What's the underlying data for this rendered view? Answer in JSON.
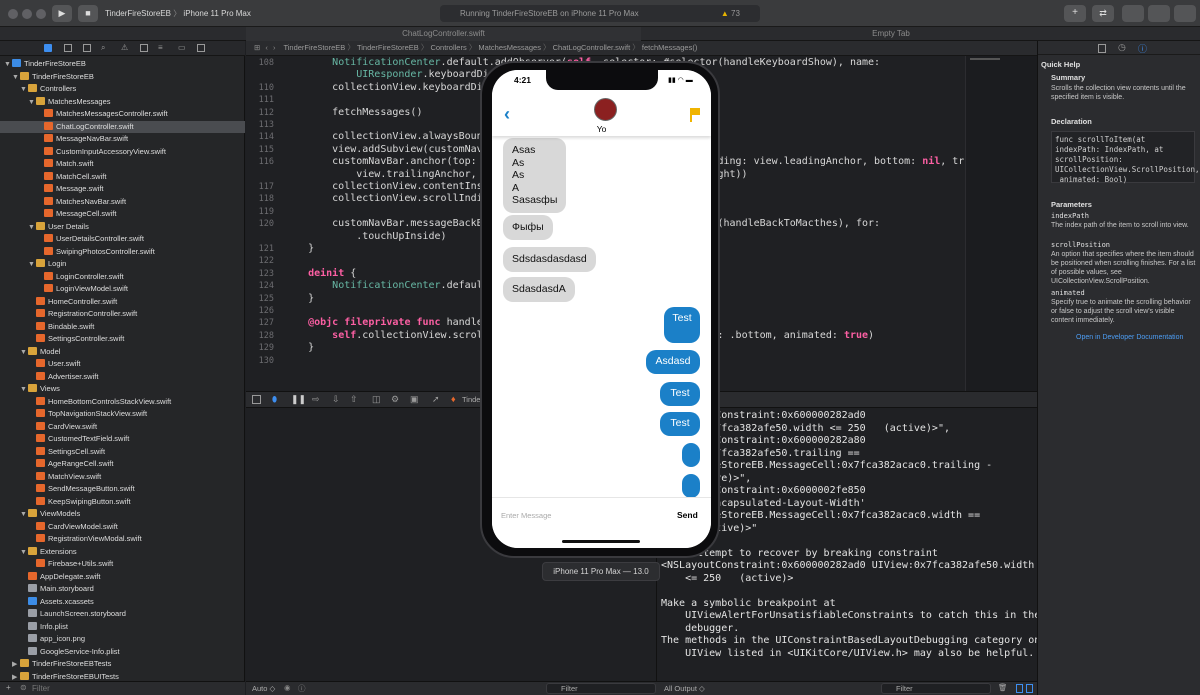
{
  "toolbar": {
    "scheme": "TinderFireStoreEB",
    "device": "iPhone 11 Pro Max",
    "status": "Running TinderFireStoreEB on iPhone 11 Pro Max",
    "warning_count": "73"
  },
  "tabs": [
    "ChatLogController.swift",
    "Empty Tab"
  ],
  "jumpbar": [
    "TinderFireStoreEB",
    "TinderFireStoreEB",
    "Controllers",
    "MatchesMessages",
    "ChatLogController.swift",
    "fetchMessages()"
  ],
  "tree": [
    {
      "label": "TinderFireStoreEB",
      "depth": 0,
      "type": "blu",
      "arrow": "▼"
    },
    {
      "label": "TinderFireStoreEB",
      "depth": 1,
      "type": "fold",
      "arrow": "▼"
    },
    {
      "label": "Controllers",
      "depth": 2,
      "type": "fold",
      "arrow": "▼"
    },
    {
      "label": "MatchesMessages",
      "depth": 3,
      "type": "fold",
      "arrow": "▼"
    },
    {
      "label": "MatchesMessagesController.swift",
      "depth": 4,
      "type": "sw",
      "arrow": ""
    },
    {
      "label": "ChatLogController.swift",
      "depth": 4,
      "type": "sw",
      "arrow": "",
      "selected": true
    },
    {
      "label": "MessageNavBar.swift",
      "depth": 4,
      "type": "sw",
      "arrow": ""
    },
    {
      "label": "CustomInputAccessoryView.swift",
      "depth": 4,
      "type": "sw",
      "arrow": ""
    },
    {
      "label": "Match.swift",
      "depth": 4,
      "type": "sw",
      "arrow": ""
    },
    {
      "label": "MatchCell.swift",
      "depth": 4,
      "type": "sw",
      "arrow": ""
    },
    {
      "label": "Message.swift",
      "depth": 4,
      "type": "sw",
      "arrow": ""
    },
    {
      "label": "MatchesNavBar.swift",
      "depth": 4,
      "type": "sw",
      "arrow": ""
    },
    {
      "label": "MessageCell.swift",
      "depth": 4,
      "type": "sw",
      "arrow": ""
    },
    {
      "label": "User Details",
      "depth": 3,
      "type": "fold",
      "arrow": "▼"
    },
    {
      "label": "UserDetailsController.swift",
      "depth": 4,
      "type": "sw",
      "arrow": ""
    },
    {
      "label": "SwipingPhotosController.swift",
      "depth": 4,
      "type": "sw",
      "arrow": ""
    },
    {
      "label": "Login",
      "depth": 3,
      "type": "fold",
      "arrow": "▼"
    },
    {
      "label": "LoginController.swift",
      "depth": 4,
      "type": "sw",
      "arrow": ""
    },
    {
      "label": "LoginViewModel.swift",
      "depth": 4,
      "type": "sw",
      "arrow": ""
    },
    {
      "label": "HomeController.swift",
      "depth": 3,
      "type": "sw",
      "arrow": ""
    },
    {
      "label": "RegistrationController.swift",
      "depth": 3,
      "type": "sw",
      "arrow": ""
    },
    {
      "label": "Bindable.swift",
      "depth": 3,
      "type": "sw",
      "arrow": ""
    },
    {
      "label": "SettingsController.swift",
      "depth": 3,
      "type": "sw",
      "arrow": ""
    },
    {
      "label": "Model",
      "depth": 2,
      "type": "fold",
      "arrow": "▼"
    },
    {
      "label": "User.swift",
      "depth": 3,
      "type": "sw",
      "arrow": ""
    },
    {
      "label": "Advertiser.swift",
      "depth": 3,
      "type": "sw",
      "arrow": ""
    },
    {
      "label": "Views",
      "depth": 2,
      "type": "fold",
      "arrow": "▼"
    },
    {
      "label": "HomeBottomControlsStackView.swift",
      "depth": 3,
      "type": "sw",
      "arrow": ""
    },
    {
      "label": "TopNavigationStackView.swift",
      "depth": 3,
      "type": "sw",
      "arrow": ""
    },
    {
      "label": "CardView.swift",
      "depth": 3,
      "type": "sw",
      "arrow": ""
    },
    {
      "label": "CustomedTextField.swift",
      "depth": 3,
      "type": "sw",
      "arrow": ""
    },
    {
      "label": "SettingsCell.swift",
      "depth": 3,
      "type": "sw",
      "arrow": ""
    },
    {
      "label": "AgeRangeCell.swift",
      "depth": 3,
      "type": "sw",
      "arrow": ""
    },
    {
      "label": "MatchView.swift",
      "depth": 3,
      "type": "sw",
      "arrow": ""
    },
    {
      "label": "SendMessageButton.swift",
      "depth": 3,
      "type": "sw",
      "arrow": ""
    },
    {
      "label": "KeepSwipingButton.swift",
      "depth": 3,
      "type": "sw",
      "arrow": ""
    },
    {
      "label": "ViewModels",
      "depth": 2,
      "type": "fold",
      "arrow": "▼"
    },
    {
      "label": "CardViewModel.swift",
      "depth": 3,
      "type": "sw",
      "arrow": ""
    },
    {
      "label": "RegistrationViewModal.swift",
      "depth": 3,
      "type": "sw",
      "arrow": ""
    },
    {
      "label": "Extensions",
      "depth": 2,
      "type": "fold",
      "arrow": "▼"
    },
    {
      "label": "Firebase+Utils.swift",
      "depth": 3,
      "type": "sw",
      "arrow": ""
    },
    {
      "label": "AppDelegate.swift",
      "depth": 2,
      "type": "sw",
      "arrow": ""
    },
    {
      "label": "Main.storyboard",
      "depth": 2,
      "type": "oth",
      "arrow": ""
    },
    {
      "label": "Assets.xcassets",
      "depth": 2,
      "type": "blu",
      "arrow": ""
    },
    {
      "label": "LaunchScreen.storyboard",
      "depth": 2,
      "type": "oth",
      "arrow": ""
    },
    {
      "label": "Info.plist",
      "depth": 2,
      "type": "oth",
      "arrow": ""
    },
    {
      "label": "app_icon.png",
      "depth": 2,
      "type": "oth",
      "arrow": ""
    },
    {
      "label": "GoogleService-Info.plist",
      "depth": 2,
      "type": "oth",
      "arrow": ""
    },
    {
      "label": "TinderFireStoreEBTests",
      "depth": 1,
      "type": "fold",
      "arrow": "▶"
    },
    {
      "label": "TinderFireStoreEBUITests",
      "depth": 1,
      "type": "fold",
      "arrow": "▶"
    }
  ],
  "code": [
    {
      "n": "108",
      "html": "    NotificationCenter.default.addObserver(self, selector: #selector(handleKeyboardShow), name:"
    },
    {
      "n": "",
      "html": "        UIResponder.keyboardDidShowNotification, object: nil)"
    },
    {
      "n": "110",
      "html": "    collectionView.keyboardDismissMode = .interactive"
    },
    {
      "n": "111",
      "html": ""
    },
    {
      "n": "112",
      "html": "    fetchMessages()"
    },
    {
      "n": "113",
      "html": ""
    },
    {
      "n": "114",
      "html": "    collectionView.alwaysBounceVertical = true"
    },
    {
      "n": "115",
      "html": "    view.addSubview(customNavBar)"
    },
    {
      "n": "116",
      "html": "    customNavBar.anchor(top: view.safeAreaLayoutGuide.topAnchor, leading: view.leadingAnchor, bottom: nil, trailing:"
    },
    {
      "n": "",
      "html": "        view.trailingAnchor, size: .init(width: 0, height: navBarHeight))"
    },
    {
      "n": "117",
      "html": "    collectionView.contentInset.top = navBarHeight"
    },
    {
      "n": "118",
      "html": "    collectionView.scrollIndicatorInsets.top = navBarHeight"
    },
    {
      "n": "119",
      "html": ""
    },
    {
      "n": "120",
      "html": "    customNavBar.messageBackButton.addTarget(self, action: #selector(handleBackToMacthes), for:"
    },
    {
      "n": "",
      "html": "        .touchUpInside)"
    },
    {
      "n": "121",
      "html": "}"
    },
    {
      "n": "122",
      "html": ""
    },
    {
      "n": "123",
      "html": "deinit {"
    },
    {
      "n": "124",
      "html": "    NotificationCenter.default.removeObserver(self)"
    },
    {
      "n": "125",
      "html": "}"
    },
    {
      "n": "126",
      "html": ""
    },
    {
      "n": "127",
      "html": "@objc fileprivate func handleKeyboardShow() {"
    },
    {
      "n": "128",
      "html": "    self.collectionView.scrollToItem(at: [0, messages.count - 1], at: .bottom, animated: true)"
    },
    {
      "n": "129",
      "html": "}"
    },
    {
      "n": "130",
      "html": ""
    }
  ],
  "console": [
    "<NSLayoutConstraint:0x600000282ad0",
    "UIView:0x7fca382afe50.width <= 250   (active)>\",",
    "<NSLayoutConstraint:0x600000282a80",
    "UIView:0x7fca382afe50.trailing ==",
    "TinderFireStoreEB.MessageCell:0x7fca382acac0.trailing -",
    "    (active)>\",",
    "<NSLayoutConstraint:0x6000002fe850",
    "'UIView-Encapsulated-Layout-Width'",
    "TinderFireStoreEB.MessageCell:0x7fca382acac0.width ==",
    "414   (active)>\"",
    "",
    "Will attempt to recover by breaking constraint",
    "<NSLayoutConstraint:0x600000282ad0 UIView:0x7fca382afe50.width",
    "    <= 250   (active)>",
    "",
    "Make a symbolic breakpoint at",
    "    UIViewAlertForUnsatisfiableConstraints to catch this in the",
    "    debugger.",
    "The methods in the UIConstraintBasedLayoutDebugging category on",
    "    UIView listed in <UIKitCore/UIView.h> may also be helpful."
  ],
  "inspector": {
    "title": "Quick Help",
    "summary_h": "Summary",
    "summary": "Scrolls the collection view contents until the specified item is visible.",
    "decl_h": "Declaration",
    "decl": "func scrollToItem(at\nindexPath: IndexPath, at\nscrollPosition:\nUICollectionView.ScrollPosition,\n animated: Bool)",
    "params_h": "Parameters",
    "p1": "indexPath",
    "p1d": "The index path of the item to scroll into view.",
    "p2": "scrollPosition",
    "p2d": "An option that specifies where the item should be positioned when scrolling finishes. For a list of possible values, see UICollectionView.ScrollPosition.",
    "p3": "animated",
    "p3d": "Specify true to animate the scrolling behavior or false to adjust the scroll view's visible content immediately.",
    "link": "Open in Developer Documentation"
  },
  "phone": {
    "time": "4:21",
    "name": "Yo",
    "placeholder": "Enter Message",
    "send": "Send",
    "sim_label": "iPhone 11 Pro Max — 13.0",
    "gray_bubbles": [
      "Asas\nAs\nAs\nA\nSasasфы",
      "Фыфы",
      "Sdsdasdasdasd",
      "SdasdasdA"
    ],
    "blue_bubbles": [
      "Test",
      "Asdasd",
      "Test",
      "Test",
      "",
      ""
    ]
  },
  "bottom": {
    "auto": "Auto",
    "filter": "Filter",
    "all_output": "All Output",
    "nav_filter": "Filter"
  },
  "colors": {
    "accent": "#1b80c8",
    "flag": "#f0b400",
    "folder": "#d8a33b",
    "swift": "#e6672c"
  }
}
